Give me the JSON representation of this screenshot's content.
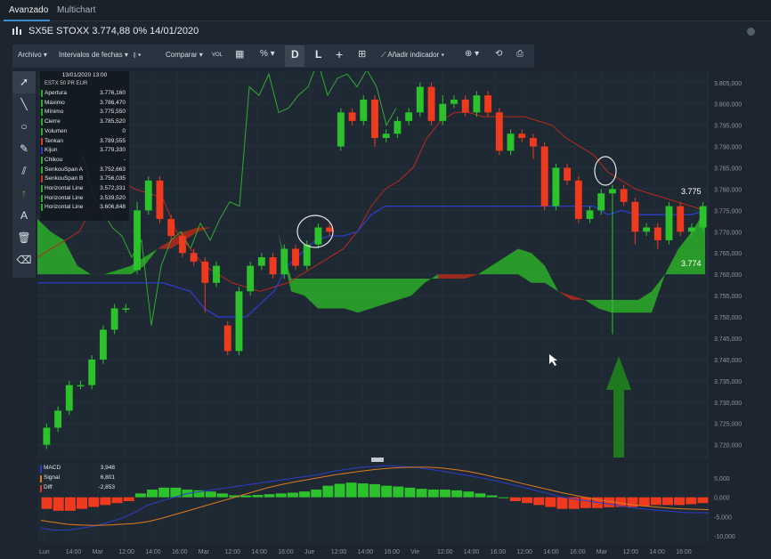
{
  "tabs": {
    "items": [
      "Avanzado",
      "Multichart"
    ]
  },
  "title": {
    "text": "SX5E STOXX 3.774,88 0% 14/01/2020"
  },
  "toolbar": {
    "archivo": "Archivo",
    "intervalos": "Intervalos de fechas",
    "comparar": "Comparar",
    "vol": "VOL",
    "percent": "%",
    "d": "D",
    "l": "L",
    "add_indicator": "Añadir indicador"
  },
  "legend": {
    "date": "13/01/2020 13:00",
    "instrument": "ESTX 50 PR EUR",
    "rows": [
      {
        "name": "Apertura",
        "value": "3.776,160",
        "color": "#2faa2f"
      },
      {
        "name": "Máximo",
        "value": "3.786,470",
        "color": "#2faa2f"
      },
      {
        "name": "Mínimo",
        "value": "3.775,550",
        "color": "#2faa2f"
      },
      {
        "name": "Cierre",
        "value": "3.785,520",
        "color": "#2faa2f"
      },
      {
        "name": "Volumen",
        "value": "0",
        "color": "#2faa2f"
      },
      {
        "name": "Tenkan",
        "value": "3.789,555",
        "color": "#d23a2a"
      },
      {
        "name": "Kijun",
        "value": "3.779,330",
        "color": "#2c3cc8"
      },
      {
        "name": "Chikou",
        "value": "-",
        "color": "#2faa2f"
      },
      {
        "name": "SenkouSpan A",
        "value": "3.752,663",
        "color": "#2faa2f"
      },
      {
        "name": "SenkouSpan B",
        "value": "3.756,035",
        "color": "#c23a2a"
      },
      {
        "name": "Horizontal Line",
        "value": "3.572,331",
        "color": "#2faa2f"
      },
      {
        "name": "Horizontal Line",
        "value": "3.539,520",
        "color": "#2faa2f"
      },
      {
        "name": "Horizontal Line",
        "value": "3.606,848",
        "color": "#2faa2f"
      }
    ]
  },
  "macd_legend": {
    "rows": [
      {
        "name": "MACD",
        "value": "3,948",
        "color": "#2c3cc8"
      },
      {
        "name": "Signal",
        "value": "6,801",
        "color": "#e07a20"
      },
      {
        "name": "Diff",
        "value": "-2,853",
        "color": "#d23a2a"
      }
    ]
  },
  "price_labels": {
    "upper": "3.775",
    "lower": "3.774"
  },
  "chart_data": [
    {
      "type": "candlestick",
      "title": "SX5E STOXX",
      "ylim": [
        3717,
        3806
      ],
      "y_ticks": [
        "3.805,000",
        "3.800,000",
        "3.795,000",
        "3.790,000",
        "3.785,000",
        "3.780,000",
        "3.775,000",
        "3.770,000",
        "3.765,000",
        "3.760,000",
        "3.755,000",
        "3.750,000",
        "3.745,000",
        "3.740,000",
        "3.735,000",
        "3.730,000",
        "3.725,000",
        "3.720,000"
      ],
      "x_ticks": [
        "Lun",
        "14:00",
        "Mar",
        "12:00",
        "14:00",
        "16:00",
        "Mar",
        "12:00",
        "14:00",
        "16:00",
        "Jue",
        "12:00",
        "14:00",
        "16:00",
        "Vie",
        "12:00",
        "14:00",
        "16:00",
        "12:00",
        "14:00",
        "16:00",
        "Mar",
        "12:00",
        "14:00",
        "16:00"
      ],
      "candles": [
        [
          3720,
          3724,
          3719,
          3725
        ],
        [
          3724,
          3728,
          3723,
          3729
        ],
        [
          3728,
          3734,
          3727,
          3735
        ],
        [
          3734,
          3734,
          3733,
          3735
        ],
        [
          3734,
          3740,
          3733,
          3741
        ],
        [
          3740,
          3747,
          3739,
          3748
        ],
        [
          3747,
          3752,
          3746,
          3753
        ],
        [
          3752,
          3752,
          3751,
          3753
        ],
        [
          3761,
          3775,
          3760,
          3777
        ],
        [
          3775,
          3782,
          3774,
          3783
        ],
        [
          3782,
          3773,
          3772,
          3783
        ],
        [
          3773,
          3769,
          3768,
          3774
        ],
        [
          3769,
          3765,
          3764,
          3770
        ],
        [
          3765,
          3763,
          3762,
          3766
        ],
        [
          3763,
          3758,
          3751,
          3764
        ],
        [
          3758,
          3762,
          3757,
          3763
        ],
        [
          3748,
          3742,
          3741,
          3749
        ],
        [
          3742,
          3756,
          3741,
          3757
        ],
        [
          3756,
          3762,
          3755,
          3763
        ],
        [
          3762,
          3764,
          3761,
          3765
        ],
        [
          3764,
          3760,
          3759,
          3765
        ],
        [
          3760,
          3766,
          3759,
          3767
        ],
        [
          3766,
          3762,
          3761,
          3767
        ],
        [
          3762,
          3767,
          3761,
          3768
        ],
        [
          3767,
          3771,
          3766,
          3772
        ],
        [
          3771,
          3770,
          3769,
          3772
        ],
        [
          3790,
          3798,
          3789,
          3799
        ],
        [
          3798,
          3796,
          3795,
          3799
        ],
        [
          3796,
          3801,
          3795,
          3802
        ],
        [
          3801,
          3792,
          3790,
          3802
        ],
        [
          3792,
          3793,
          3791,
          3794
        ],
        [
          3793,
          3796,
          3792,
          3797
        ],
        [
          3796,
          3798,
          3795,
          3799
        ],
        [
          3798,
          3804,
          3797,
          3805
        ],
        [
          3804,
          3796,
          3795,
          3805
        ],
        [
          3796,
          3800,
          3795,
          3802
        ],
        [
          3800,
          3801,
          3799,
          3802
        ],
        [
          3801,
          3798,
          3797,
          3802
        ],
        [
          3798,
          3802,
          3797,
          3803
        ],
        [
          3802,
          3798,
          3797,
          3803
        ],
        [
          3798,
          3789,
          3788,
          3799
        ],
        [
          3789,
          3793,
          3788,
          3794
        ],
        [
          3793,
          3792,
          3791,
          3794
        ],
        [
          3792,
          3790,
          3787,
          3793
        ],
        [
          3790,
          3776,
          3775,
          3791
        ],
        [
          3776,
          3785,
          3775,
          3786
        ],
        [
          3785,
          3782,
          3781,
          3786
        ],
        [
          3782,
          3773,
          3772,
          3783
        ],
        [
          3773,
          3775,
          3772,
          3776
        ],
        [
          3775,
          3779,
          3774,
          3780
        ],
        [
          3779,
          3780,
          3746,
          3781
        ],
        [
          3780,
          3777,
          3776,
          3781
        ],
        [
          3777,
          3770,
          3767,
          3778
        ],
        [
          3770,
          3771,
          3769,
          3772
        ],
        [
          3771,
          3768,
          3766,
          3772
        ],
        [
          3768,
          3776,
          3767,
          3777
        ],
        [
          3776,
          3770,
          3769,
          3777
        ],
        [
          3770,
          3771,
          3769,
          3772
        ],
        [
          3771,
          3776,
          3770,
          3777
        ]
      ],
      "tenkan": [
        3764,
        3766,
        3768,
        3770,
        3776,
        3786,
        3782,
        3780,
        3779,
        3778,
        3770,
        3766,
        3762,
        3760,
        3758,
        3757,
        3756,
        3757,
        3758,
        3760,
        3762,
        3764,
        3766,
        3770,
        3776,
        3780,
        3782,
        3785,
        3792,
        3796,
        3798,
        3798,
        3797,
        3797,
        3797,
        3797,
        3796,
        3795,
        3792,
        3790,
        3788,
        3784,
        3782,
        3780,
        3779,
        3778,
        3777,
        3776,
        3775
      ],
      "kijun": [
        3758,
        3758,
        3758,
        3758,
        3758,
        3758,
        3758,
        3758,
        3758,
        3758,
        3757,
        3756,
        3752,
        3750,
        3750,
        3750,
        3753,
        3756,
        3762,
        3765,
        3768,
        3769,
        3769,
        3770,
        3774,
        3776,
        3776,
        3776,
        3776,
        3776,
        3776,
        3776,
        3776,
        3776,
        3776,
        3776,
        3776,
        3776,
        3776,
        3776,
        3776,
        3774,
        3775,
        3774,
        3774,
        3774,
        3774,
        3774,
        3775
      ],
      "span_a": [
        3773,
        3770,
        3768,
        3762,
        3760,
        3760,
        3761,
        3762,
        3764,
        3766,
        3766,
        3768,
        3770,
        3771,
        3771,
        3771,
        3771,
        3771,
        3770,
        3759,
        3759,
        3759,
        3759,
        3759,
        3759,
        3759,
        3759,
        3759,
        3759,
        3759,
        3759,
        3759,
        3759,
        3760,
        3762,
        3764,
        3766,
        3765,
        3762,
        3756,
        3754,
        3754,
        3754,
        3754,
        3754,
        3754,
        3756,
        3760,
        3766,
        3770,
        3775
      ],
      "span_b": [
        3760,
        3760,
        3760,
        3760,
        3760,
        3760,
        3760,
        3760,
        3762,
        3766,
        3768,
        3770,
        3771,
        3771,
        3771,
        3771,
        3771,
        3771,
        3770,
        3756,
        3755,
        3752,
        3752,
        3752,
        3751,
        3752,
        3753,
        3754,
        3755,
        3758,
        3760,
        3760,
        3760,
        3760,
        3760,
        3760,
        3760,
        3758,
        3758,
        3756,
        3755,
        3754,
        3752,
        3751,
        3751,
        3751,
        3751,
        3760,
        3760,
        3760,
        3760
      ]
    },
    {
      "type": "bar",
      "title": "MACD",
      "ylim": [
        -10000,
        8000
      ],
      "y_ticks": [
        "5,000",
        "0,000",
        "-5,000",
        "-10,000"
      ],
      "series": [
        {
          "name": "Diff",
          "values": [
            -3,
            -3.5,
            -3.5,
            -3,
            -2.5,
            -2,
            -1.5,
            -1,
            1,
            2,
            2.5,
            2.5,
            2,
            1.8,
            1.5,
            1,
            0.5,
            0.5,
            0.6,
            0.8,
            1,
            1.2,
            1.5,
            2,
            3,
            3.5,
            3.8,
            3.6,
            3.4,
            3,
            2.8,
            2.5,
            2.2,
            2,
            2,
            1.8,
            1.5,
            1,
            0.5,
            0,
            -1,
            -1.5,
            -2,
            -2.5,
            -3,
            -3,
            -2.8,
            -2.8,
            -2.6,
            -2.5,
            -2.5,
            -2.3,
            -2,
            -2,
            -2,
            -1.8,
            -1.5
          ]
        },
        {
          "name": "MACD",
          "values": [
            -8,
            -8.5,
            -8.5,
            -8,
            -7.5,
            -6.5,
            -5.5,
            -4,
            -2,
            -1,
            0,
            1,
            1.5,
            2,
            2.5,
            3,
            3.5,
            4,
            4.5,
            5,
            5.5,
            6,
            6.8,
            7.3,
            7.8,
            8,
            8.2,
            8,
            7.8,
            7.3,
            6.8,
            6.2,
            5.6,
            5,
            4.3,
            3.5,
            2.7,
            1.8,
            1,
            0,
            -0.5,
            -1,
            -1.5,
            -2,
            -2.6,
            -3,
            -3.3,
            -3.6,
            -3.9,
            -4,
            -4
          ]
        },
        {
          "name": "Signal",
          "values": [
            -6,
            -6.5,
            -7,
            -7.2,
            -7.3,
            -7.2,
            -7,
            -6.8,
            -6.3,
            -5.5,
            -4.5,
            -3.5,
            -2.5,
            -1.5,
            -0.5,
            0.5,
            1.5,
            2.5,
            3.3,
            4,
            4.6,
            5.2,
            5.8,
            6.3,
            6.8,
            7.2,
            7.5,
            7.7,
            7.8,
            7.8,
            7.6,
            7.2,
            6.7,
            6,
            5.2,
            4.5,
            3.6,
            2.8,
            2,
            1.2,
            0.5,
            -0.2,
            -0.8,
            -1.3,
            -1.8,
            -2.2,
            -2.5,
            -2.8,
            -3,
            -3.1,
            -3.2
          ]
        }
      ]
    }
  ]
}
